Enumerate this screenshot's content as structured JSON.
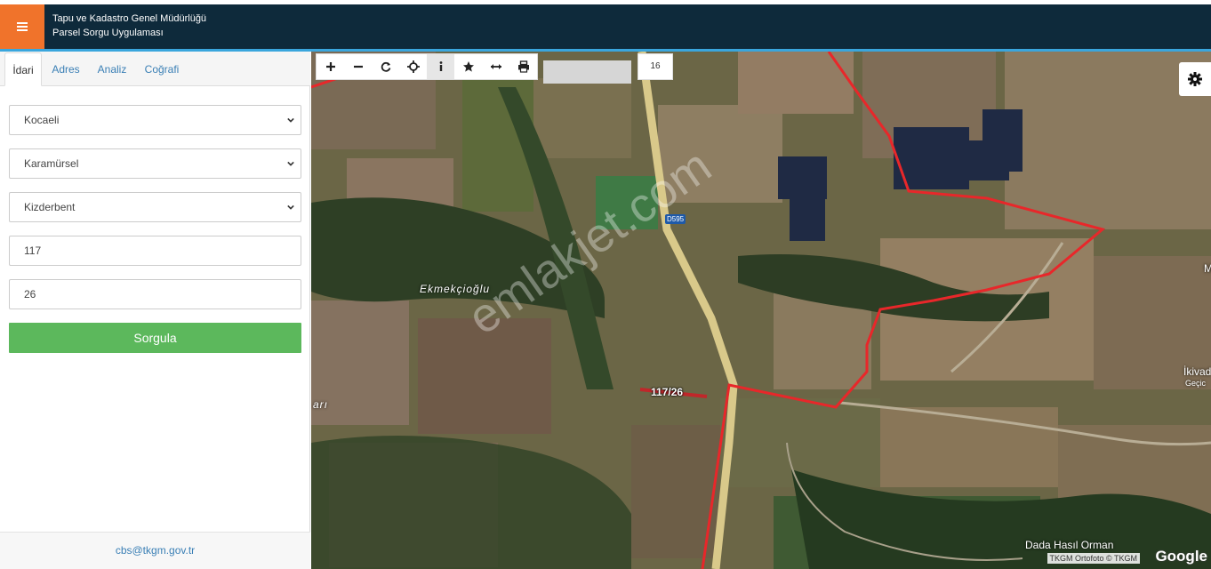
{
  "header": {
    "title_line1": "Tapu ve Kadastro Genel Müdürlüğü",
    "title_line2": "Parsel Sorgu Uygulaması"
  },
  "sidebar": {
    "tabs": [
      {
        "label": "İdari",
        "active": true
      },
      {
        "label": "Adres"
      },
      {
        "label": "Analiz"
      },
      {
        "label": "Coğrafi"
      }
    ],
    "fields": {
      "il": "Kocaeli",
      "ilce": "Karamürsel",
      "mahalle": "Kizderbent",
      "ada": "117",
      "parsel": "26"
    },
    "submit_label": "Sorgula",
    "footer_email": "cbs@tkgm.gov.tr"
  },
  "map": {
    "toolbar_icons": [
      "zoom-in-icon",
      "zoom-out-icon",
      "refresh-icon",
      "locate-icon",
      "info-icon",
      "star-icon",
      "measure-icon",
      "print-icon"
    ],
    "zoom_level": "16",
    "parcel_label": "117/26",
    "place_ekmekcioglu": "Ekmekçioğlu",
    "place_ari": "arı",
    "place_ikivad": "İkivad",
    "place_gecic": "Geçic",
    "place_m": "M",
    "place_dada": "Dada Hasıl Orman",
    "road_label": "D595",
    "watermark": "emlakjet.com",
    "attribution": "TKGM Ortofoto © TKGM",
    "google": "Google",
    "colors": {
      "parcel_border": "#e8272a",
      "accent_orange": "#f0732b",
      "header_bg": "#0e2a3b",
      "submit_green": "#5cb85c"
    }
  }
}
